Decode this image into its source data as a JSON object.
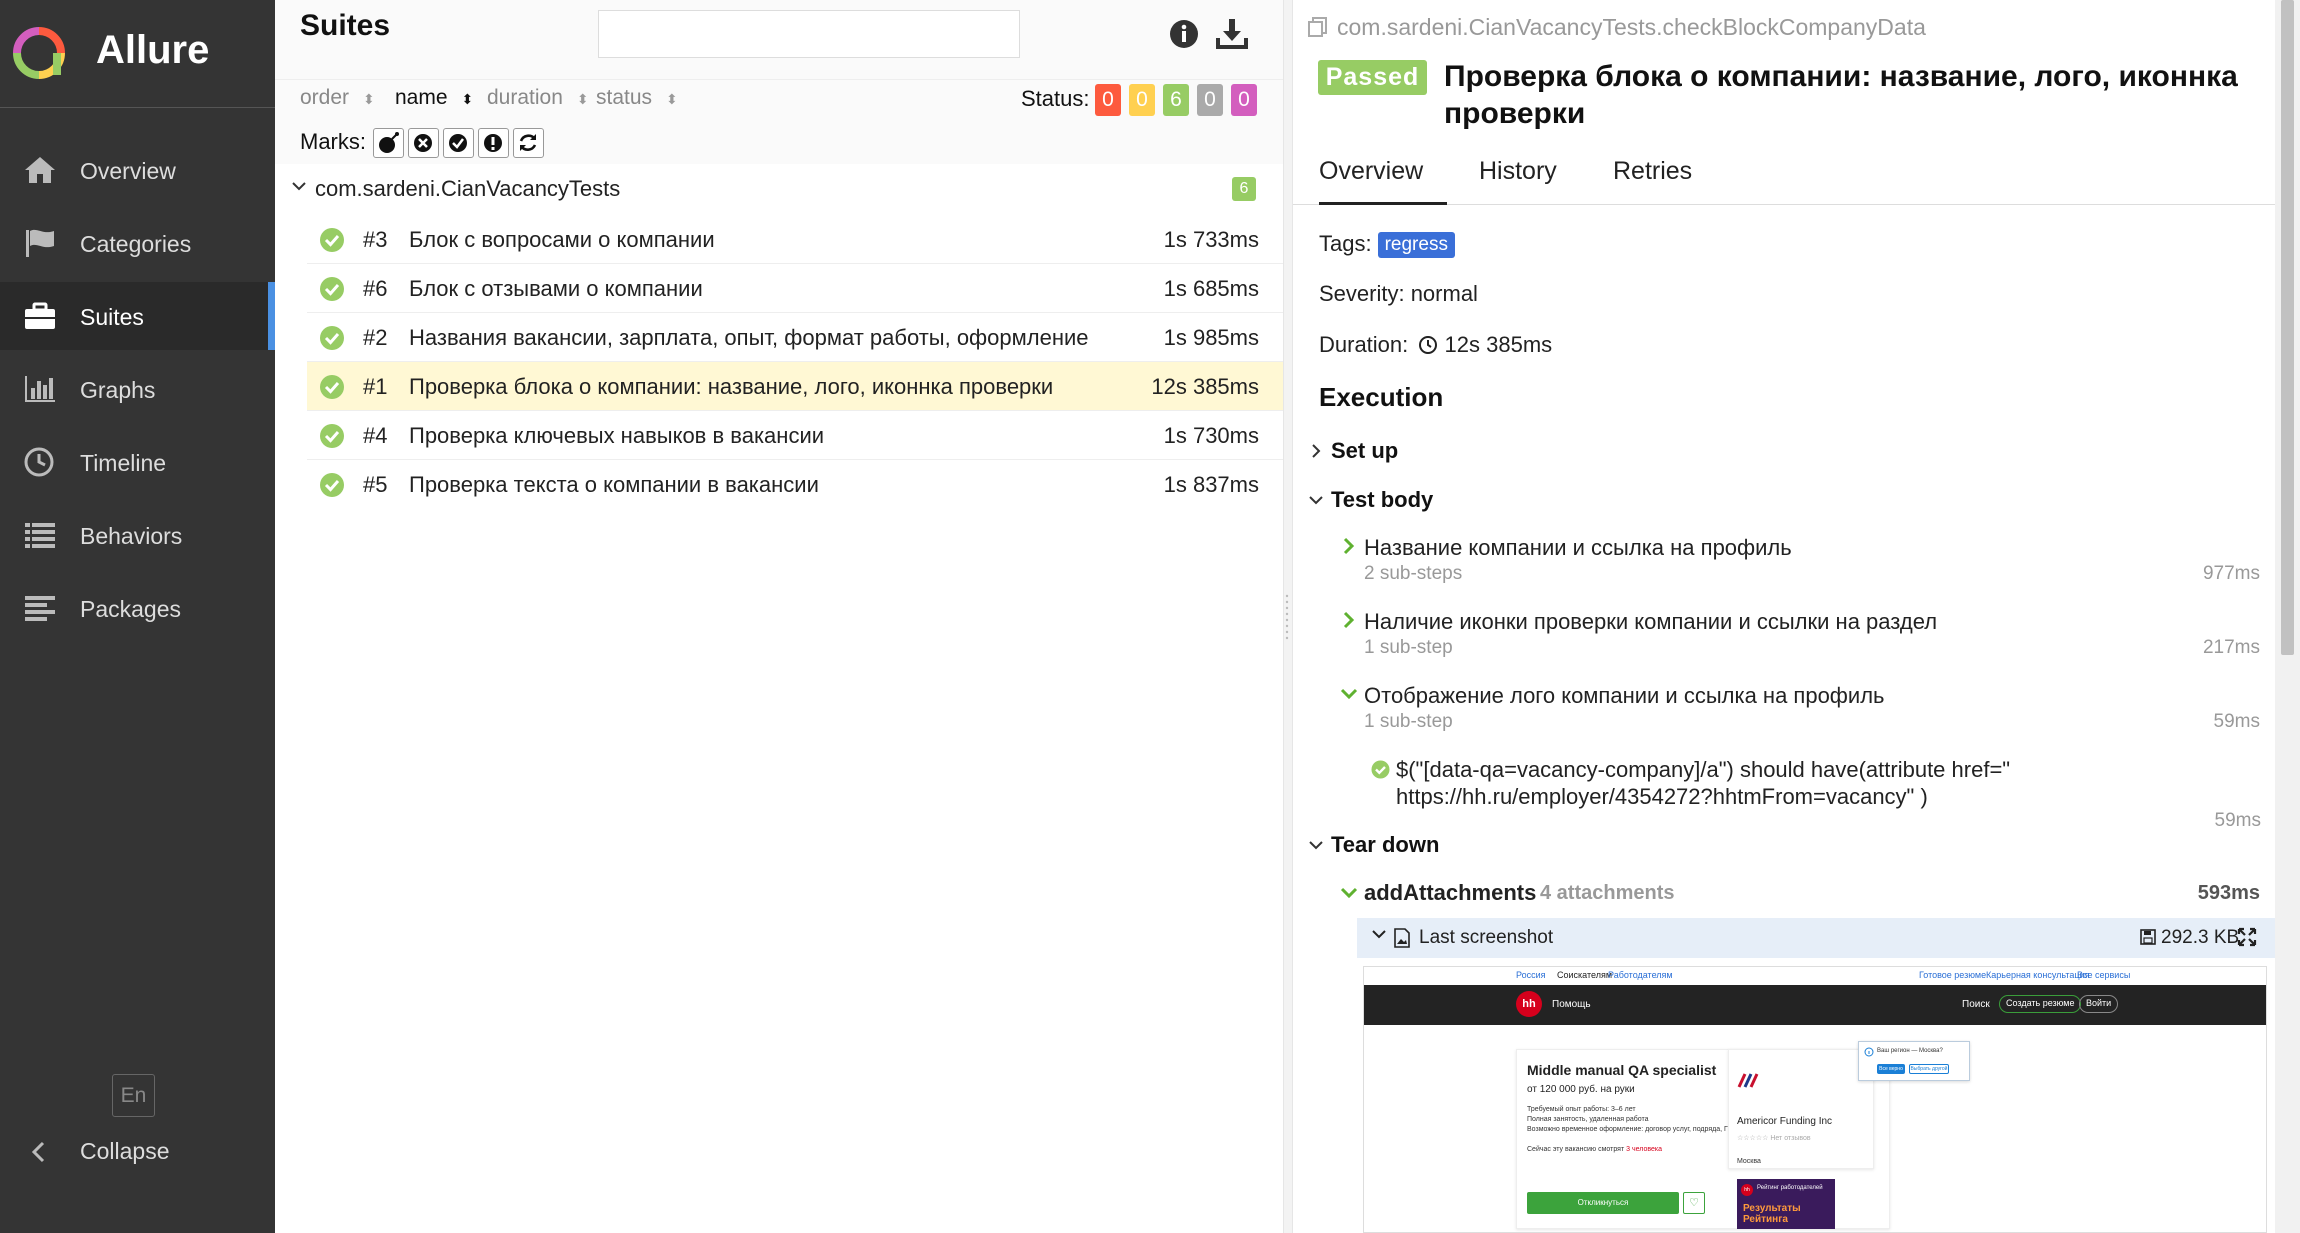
{
  "sidebar": {
    "brand": "Allure",
    "items": [
      {
        "label": "Overview",
        "icon": "home-icon"
      },
      {
        "label": "Categories",
        "icon": "flag-icon"
      },
      {
        "label": "Suites",
        "icon": "briefcase-icon",
        "active": true
      },
      {
        "label": "Graphs",
        "icon": "bar-chart-icon"
      },
      {
        "label": "Timeline",
        "icon": "clock-icon"
      },
      {
        "label": "Behaviors",
        "icon": "list-icon"
      },
      {
        "label": "Packages",
        "icon": "align-left-icon"
      }
    ],
    "language": "En",
    "collapse": "Collapse"
  },
  "suites": {
    "title": "Suites",
    "search_value": "",
    "sort": [
      "order",
      "name",
      "duration",
      "status"
    ],
    "active_sort": "name",
    "status_label": "Status:",
    "status_counts": [
      {
        "value": "0",
        "color": "#fd5a3e"
      },
      {
        "value": "0",
        "color": "#ffd050"
      },
      {
        "value": "6",
        "color": "#97cc64"
      },
      {
        "value": "0",
        "color": "#aaaaaa"
      },
      {
        "value": "0",
        "color": "#d35ebe"
      }
    ],
    "marks_label": "Marks:",
    "marks": [
      "bomb-icon",
      "times-circle-icon",
      "check-circle-icon",
      "exclamation-circle-icon",
      "refresh-icon"
    ],
    "group": {
      "name": "com.sardeni.CianVacancyTests",
      "count": "6"
    },
    "rows": [
      {
        "num": "#3",
        "title": "Блок с вопросами о компании",
        "duration": "1s 733ms"
      },
      {
        "num": "#6",
        "title": "Блок с отзывами о компании",
        "duration": "1s 685ms"
      },
      {
        "num": "#2",
        "title": "Названия вакансии, зарплата, опыт, формат работы, оформление",
        "duration": "1s 985ms"
      },
      {
        "num": "#1",
        "title": "Проверка блока о компании: название, лого, иконнка проверки",
        "duration": "12s 385ms",
        "selected": true
      },
      {
        "num": "#4",
        "title": "Проверка ключевых навыков в вакансии",
        "duration": "1s 730ms"
      },
      {
        "num": "#5",
        "title": "Проверка текста о компании в вакансии",
        "duration": "1s 837ms"
      }
    ]
  },
  "test": {
    "full_name": "com.sardeni.CianVacancyTests.checkBlockCompanyData",
    "status": "Passed",
    "title": "Проверка блока о компании: название, лого, иконнка проверки",
    "tabs": [
      "Overview",
      "History",
      "Retries"
    ],
    "tags_label": "Tags:",
    "tag": "regress",
    "severity": "Severity: normal",
    "duration_label": "Duration:",
    "duration": "12s 385ms",
    "execution": "Execution",
    "setup": "Set up",
    "body": "Test body",
    "steps": [
      {
        "title": "Название компании и ссылка на профиль",
        "sub": "2 sub-steps",
        "duration": "977ms"
      },
      {
        "title": "Наличие иконки проверки компании и ссылки на раздел",
        "sub": "1 sub-step",
        "duration": "217ms"
      },
      {
        "title": "Отображение лого компании и ссылка на профиль",
        "sub": "1 sub-step",
        "duration": "59ms"
      }
    ],
    "assertion": "$(\"[data-qa=vacancy-company]/a\") should have(attribute href=\" https://hh.ru/employer/4354272?hhtmFrom=vacancy\" )",
    "assertion_duration": "59ms",
    "teardown": "Tear down",
    "attach_step": {
      "name": "addAttachments",
      "count": "4 attachments",
      "duration": "593ms"
    },
    "attachment": {
      "name": "Last screenshot",
      "size": "292.3 KB"
    }
  },
  "screenshot": {
    "top_links": [
      "Россия",
      "Соискателям",
      "Работодателям",
      "Готовое резюме",
      "Карьерная консультация",
      "Все сервисы"
    ],
    "logo": "hh",
    "help": "Помощь",
    "search": "Поиск",
    "create_resume": "Создать резюме",
    "login": "Войти",
    "vacancy_title": "Middle manual QA specialist",
    "salary": "от 120 000 руб. на руки",
    "meta": [
      "Требуемый опыт работы: 3–6 лет",
      "Полная занятость, удаленная работа",
      "Возможно временное оформление: договор услуг, подряда, ГПХ, самозанятые, ИП"
    ],
    "viewers_prefix": "Сейчас эту вакансию смотрят",
    "viewers_count": "3 человека",
    "apply": "Откликнуться",
    "company": "Americor Funding Inc",
    "reviews": "☆☆☆☆☆ Нет отзывов",
    "city": "Москва",
    "popup_question": "Ваш регион — Москва?",
    "popup_yes": "Все верно",
    "popup_other": "Выбрать другой",
    "rating_title": "Рейтинг работодателей",
    "rating_banner": "Результаты Рейтинга"
  }
}
